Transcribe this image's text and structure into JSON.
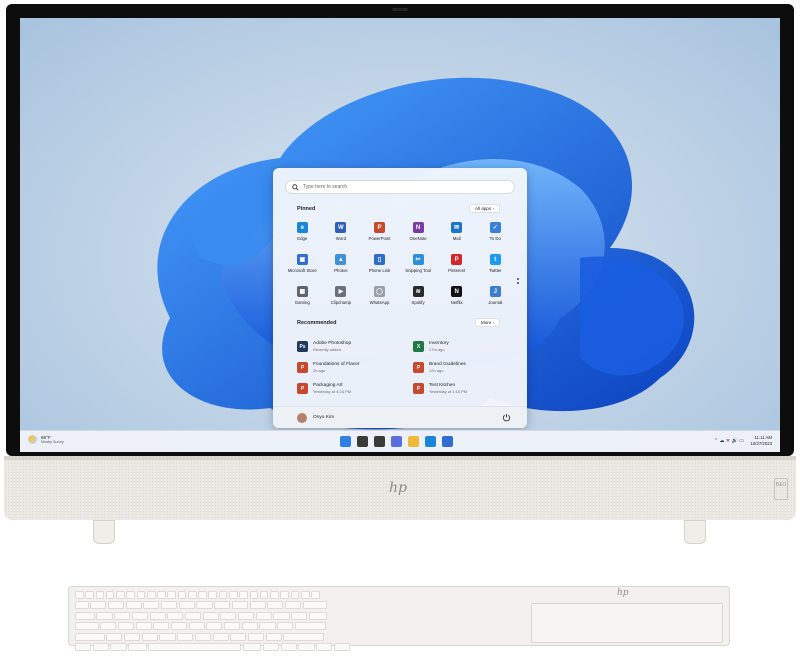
{
  "start_menu": {
    "search_placeholder": "Type here to search",
    "pinned_title": "Pinned",
    "all_apps_label": "All apps  ›",
    "pinned_apps": [
      {
        "label": "Edge",
        "color": "#1a86d9",
        "glyph": "e"
      },
      {
        "label": "Word",
        "color": "#2b5fb8",
        "glyph": "W"
      },
      {
        "label": "PowerPoint",
        "color": "#c8482b",
        "glyph": "P"
      },
      {
        "label": "OneNote",
        "color": "#7a3aa8",
        "glyph": "N"
      },
      {
        "label": "Mail",
        "color": "#1d74c9",
        "glyph": "✉"
      },
      {
        "label": "To Do",
        "color": "#3a7fe0",
        "glyph": "✓"
      },
      {
        "label": "Microsoft Store",
        "color": "#2f6dd0",
        "glyph": "▣"
      },
      {
        "label": "Photos",
        "color": "#3d93d6",
        "glyph": "▲"
      },
      {
        "label": "Phone Link",
        "color": "#2d6cc8",
        "glyph": "▯"
      },
      {
        "label": "Snipping Tool",
        "color": "#2d8fd9",
        "glyph": "✂"
      },
      {
        "label": "Pinterest",
        "color": "#d3262a",
        "glyph": "P"
      },
      {
        "label": "Twitter",
        "color": "#1d9bf0",
        "glyph": "t"
      },
      {
        "label": "Gaming",
        "color": "#5d6470",
        "glyph": "▦"
      },
      {
        "label": "Clipchamp",
        "color": "#6a6f78",
        "glyph": "▶"
      },
      {
        "label": "WhatsApp",
        "color": "#9aa0a6",
        "glyph": "◯"
      },
      {
        "label": "Spotify",
        "color": "#2a2a2a",
        "glyph": "≋"
      },
      {
        "label": "Netflix",
        "color": "#111111",
        "glyph": "N"
      },
      {
        "label": "Journal",
        "color": "#3b7dd0",
        "glyph": "J"
      }
    ],
    "recommended_title": "Recommended",
    "more_label": "More  ›",
    "recommended": [
      {
        "name": "Adobe Photoshop",
        "time": "Recently added",
        "color": "#1f3b5b",
        "glyph": "Ps"
      },
      {
        "name": "Inventory",
        "time": "17m ago",
        "color": "#1f7a44",
        "glyph": "X"
      },
      {
        "name": "Foundations of Flavor",
        "time": "2h ago",
        "color": "#c8482b",
        "glyph": "P"
      },
      {
        "name": "Brand Guidelines",
        "time": "12h ago",
        "color": "#c8482b",
        "glyph": "P"
      },
      {
        "name": "Packaging Art",
        "time": "Yesterday at 4:24 PM",
        "color": "#c8482b",
        "glyph": "P"
      },
      {
        "name": "Test Kitchen",
        "time": "Yesterday at 1:15 PM",
        "color": "#c8482b",
        "glyph": "P"
      }
    ],
    "user_name": "Onyu Kim"
  },
  "taskbar": {
    "weather_temp": "68°F",
    "weather_desc": "Mostly Sunny",
    "icons": [
      {
        "name": "windows-start-icon",
        "color": "#2f7fe6"
      },
      {
        "name": "search-icon",
        "color": "#3a3a3a"
      },
      {
        "name": "task-view-icon",
        "color": "#3a3a3a"
      },
      {
        "name": "chat-icon",
        "color": "#5b6ee0"
      },
      {
        "name": "file-explorer-icon",
        "color": "#f1b93a"
      },
      {
        "name": "edge-icon",
        "color": "#1a86d9"
      },
      {
        "name": "store-icon",
        "color": "#2f6dd0"
      }
    ],
    "tray_glyphs": "⌃  ☁  ᯤ  🔊  ▭",
    "time": "11:11 AM",
    "date": "10/27/2023"
  },
  "hardware": {
    "brand_logo": "hp",
    "speaker_logo": "B&O"
  }
}
